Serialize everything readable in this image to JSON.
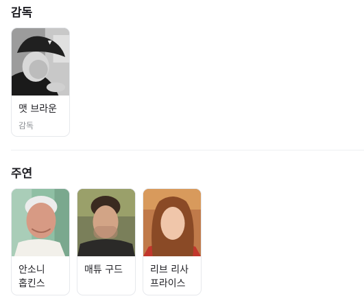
{
  "director_section": {
    "title": "감독",
    "people": [
      {
        "name": "맷 브라운",
        "role": "감독"
      }
    ]
  },
  "cast_section": {
    "title": "주연",
    "people": [
      {
        "name": "안소니 홉킨스"
      },
      {
        "name": "매튜 구드"
      },
      {
        "name": "리브 리사 프라이스"
      }
    ]
  }
}
